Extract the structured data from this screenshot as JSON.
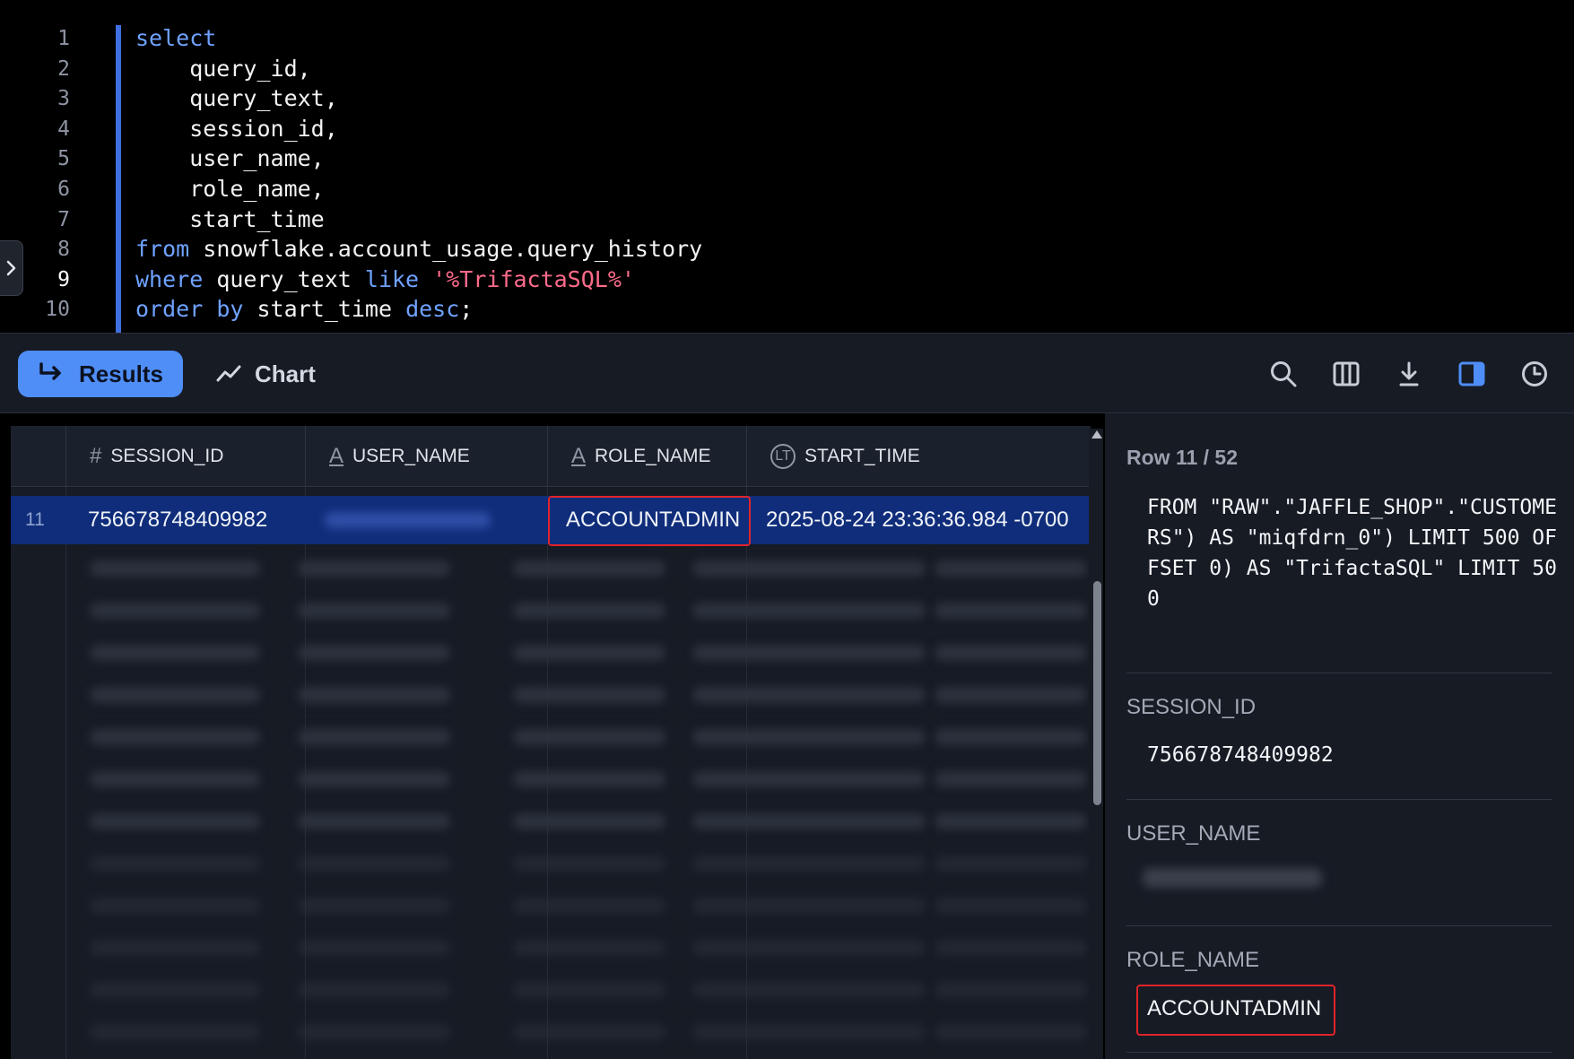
{
  "editor": {
    "line_numbers": [
      "1",
      "2",
      "3",
      "4",
      "5",
      "6",
      "7",
      "8",
      "9",
      "10"
    ],
    "lines": [
      [
        {
          "t": "select",
          "k": "kw"
        }
      ],
      [
        {
          "t": "    query_id,",
          "k": "id"
        }
      ],
      [
        {
          "t": "    query_text,",
          "k": "id"
        }
      ],
      [
        {
          "t": "    session_id,",
          "k": "id"
        }
      ],
      [
        {
          "t": "    user_name,",
          "k": "id"
        }
      ],
      [
        {
          "t": "    role_name,",
          "k": "id"
        }
      ],
      [
        {
          "t": "    start_time",
          "k": "id"
        }
      ],
      [
        {
          "t": "from",
          "k": "kw"
        },
        {
          "t": " snowflake.account_usage.query_history",
          "k": "id"
        }
      ],
      [
        {
          "t": "where",
          "k": "kw"
        },
        {
          "t": " query_text ",
          "k": "id"
        },
        {
          "t": "like",
          "k": "kw"
        },
        {
          "t": " ",
          "k": "id"
        },
        {
          "t": "'%TrifactaSQL%'",
          "k": "str"
        }
      ],
      [
        {
          "t": "order",
          "k": "kw"
        },
        {
          "t": " ",
          "k": "id"
        },
        {
          "t": "by",
          "k": "kw"
        },
        {
          "t": " start_time ",
          "k": "id"
        },
        {
          "t": "desc",
          "k": "kw"
        },
        {
          "t": ";",
          "k": "id"
        }
      ]
    ],
    "active_line": 9
  },
  "toolbar": {
    "results_label": "Results",
    "chart_label": "Chart",
    "icons": [
      "search-icon",
      "columns-icon",
      "download-icon",
      "split-panel-icon",
      "history-icon"
    ]
  },
  "grid": {
    "columns": [
      {
        "name": "SESSION_ID",
        "type_icon": "#"
      },
      {
        "name": "USER_NAME",
        "type_icon": "A"
      },
      {
        "name": "ROLE_NAME",
        "type_icon": "A"
      },
      {
        "name": "START_TIME",
        "type_icon": "LT"
      }
    ],
    "selected_row": {
      "row_number": "11",
      "session_id": "756678748409982",
      "user_name": "",
      "role_name": "ACCOUNTADMIN",
      "start_time": "2025-08-24 23:36:36.984 -0700"
    }
  },
  "detail": {
    "row_indicator": "Row 11 / 52",
    "query_text_tail": "FROM \"RAW\".\"JAFFLE_SHOP\".\"CUSTOMERS\") AS \"miqfdrn_0\") LIMIT 500 OFFSET 0) AS \"TrifactaSQL\" LIMIT 500",
    "fields": {
      "session_id_label": "SESSION_ID",
      "session_id_value": "756678748409982",
      "user_name_label": "USER_NAME",
      "role_name_label": "ROLE_NAME",
      "role_name_value": "ACCOUNTADMIN"
    }
  },
  "colors": {
    "accent": "#4f8df7",
    "keyword": "#6fa2ff",
    "string": "#ff6b8a",
    "highlight_border": "#e0242a",
    "selected_row": "#0f2d7a"
  }
}
